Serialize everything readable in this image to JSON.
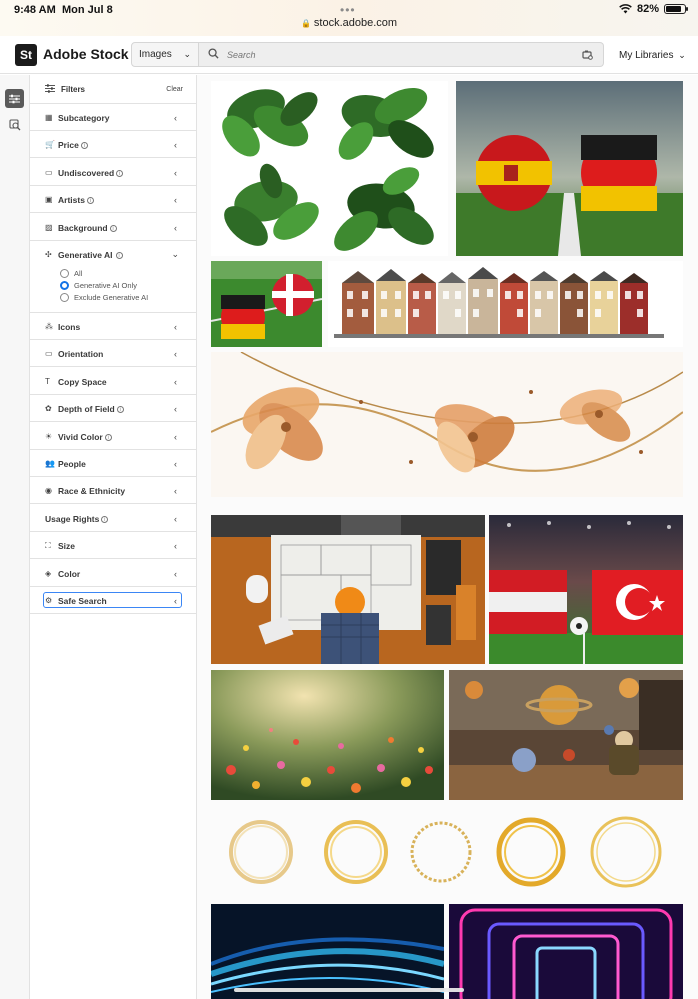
{
  "status_bar": {
    "time": "9:48 AM",
    "date": "Mon Jul 8",
    "url": "stock.adobe.com",
    "battery": "82%",
    "battery_level": 0.82
  },
  "header": {
    "logo_mark": "St",
    "logo_text": "Adobe Stock",
    "content_type": "Images",
    "search_placeholder": "Search",
    "libraries": "My Libraries"
  },
  "rail": {
    "items": [
      {
        "icon": "filter-sliders-icon",
        "active": true
      },
      {
        "icon": "visual-search-icon",
        "active": false
      }
    ]
  },
  "filters": {
    "title": "Filters",
    "clear": "Clear",
    "items": [
      {
        "label": "Subcategory",
        "icon": "subcategory-icon",
        "info": false
      },
      {
        "label": "Price",
        "icon": "cart-icon",
        "info": true
      },
      {
        "label": "Undiscovered",
        "icon": "undiscovered-icon",
        "info": true
      },
      {
        "label": "Artists",
        "icon": "artist-icon",
        "info": true
      },
      {
        "label": "Background",
        "icon": "background-icon",
        "info": true
      },
      {
        "label": "Generative AI",
        "icon": "generative-ai-icon",
        "info": true
      },
      {
        "label": "Icons",
        "icon": "icons-icon",
        "info": false
      },
      {
        "label": "Orientation",
        "icon": "orientation-icon",
        "info": false
      },
      {
        "label": "Copy Space",
        "icon": "copy-space-icon",
        "info": false
      },
      {
        "label": "Depth of Field",
        "icon": "depth-of-field-icon",
        "info": true
      },
      {
        "label": "Vivid Color",
        "icon": "vivid-color-icon",
        "info": true
      },
      {
        "label": "People",
        "icon": "people-icon",
        "info": false
      },
      {
        "label": "Race & Ethnicity",
        "icon": "race-ethnicity-icon",
        "info": false
      },
      {
        "label": "Usage Rights",
        "icon": "",
        "info": true
      },
      {
        "label": "Size",
        "icon": "size-icon",
        "info": false
      },
      {
        "label": "Color",
        "icon": "color-icon",
        "info": false
      },
      {
        "label": "Safe Search",
        "icon": "safe-search-icon",
        "info": false
      }
    ],
    "generative_ai_options": [
      {
        "label": "All",
        "selected": false
      },
      {
        "label": "Generative AI Only",
        "selected": true
      },
      {
        "label": "Exclude Generative AI",
        "selected": false
      }
    ]
  },
  "results": [
    {
      "name": "tropical-leaves"
    },
    {
      "name": "spain-germany-soccer-balls"
    },
    {
      "name": "germany-denmark-balls"
    },
    {
      "name": "row-of-houses"
    },
    {
      "name": "flower-banner"
    },
    {
      "name": "architect-blueprint"
    },
    {
      "name": "austria-turkey-flags"
    },
    {
      "name": "wildflower-meadow"
    },
    {
      "name": "child-planets-classroom"
    },
    {
      "name": "golden-rings"
    },
    {
      "name": "blue-light-trails"
    },
    {
      "name": "neon-tunnel"
    }
  ],
  "colors": {
    "accent": "#1473e6",
    "focus_ring": "#3b86f5",
    "logo_bg": "#1b1b1b"
  }
}
